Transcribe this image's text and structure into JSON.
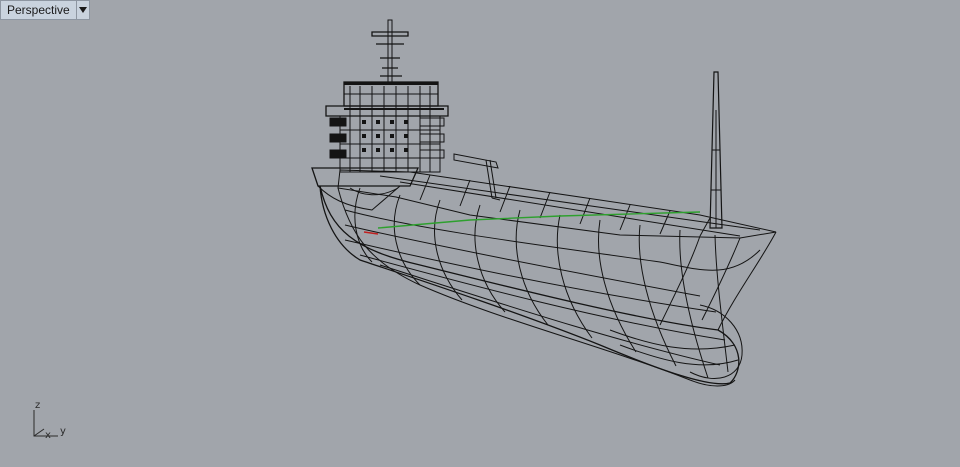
{
  "viewport": {
    "name": "Perspective",
    "menu_icon": "triangle-down-icon",
    "background": "#a1a5ab"
  },
  "axes": {
    "z": "z",
    "x": "x",
    "y": "y",
    "x_color": "#c02020",
    "y_color": "#2ea02e",
    "z_color": "#1e4fc0"
  },
  "model": {
    "line_color": "#141414"
  }
}
